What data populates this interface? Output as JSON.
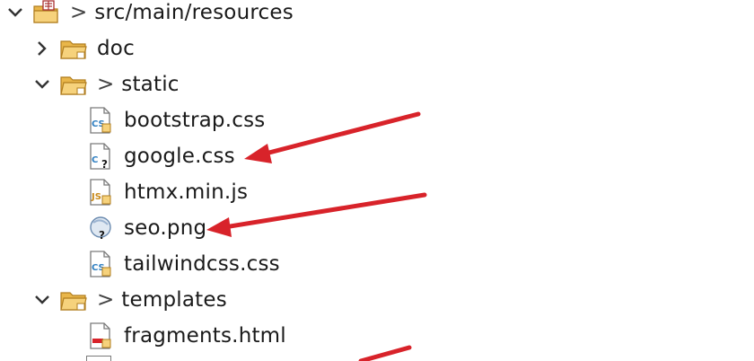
{
  "tree": {
    "root": {
      "prefix": ">",
      "label": "src/main/resources",
      "expanded": true
    },
    "items": [
      {
        "name": "folder-doc",
        "label": "doc",
        "expanded": false
      },
      {
        "name": "folder-static",
        "prefix": ">",
        "label": "static",
        "expanded": true
      },
      {
        "name": "file-bootstrap-css",
        "label": "bootstrap.css"
      },
      {
        "name": "file-google-css",
        "label": "google.css"
      },
      {
        "name": "file-htmx-min-js",
        "label": "htmx.min.js"
      },
      {
        "name": "file-seo-png",
        "label": "seo.png"
      },
      {
        "name": "file-tailwindcss-css",
        "label": "tailwindcss.css"
      },
      {
        "name": "folder-templates",
        "prefix": ">",
        "label": "templates",
        "expanded": true
      },
      {
        "name": "file-fragments-html",
        "label": "fragments.html"
      }
    ]
  },
  "colors": {
    "annotation_arrow": "#d8232a",
    "folder": "#e9b64a",
    "css_icon": "#2f7fc1"
  }
}
